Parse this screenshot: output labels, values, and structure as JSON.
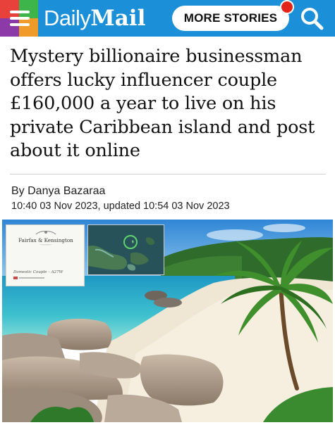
{
  "header": {
    "logo_daily": "Daily",
    "logo_mail": "Mail",
    "more_stories_label": "MORE STORIES",
    "menu_icon": "hamburger-menu-icon",
    "search_icon": "search-icon",
    "brand_color": "#1b8fd8",
    "notification_color": "#e3241b"
  },
  "article": {
    "headline": "Mystery billionaire businessman offers lucky influencer couple £160,000 a year to live on his private Caribbean island and post about it online",
    "byline": "By Danya Bazaraa",
    "dateline": "10:40 03 Nov 2023, updated 10:54 03 Nov 2023"
  },
  "image": {
    "inset_brand": "Fairfax & Kensington",
    "inset_job": "Domestic Couple – A27W"
  }
}
